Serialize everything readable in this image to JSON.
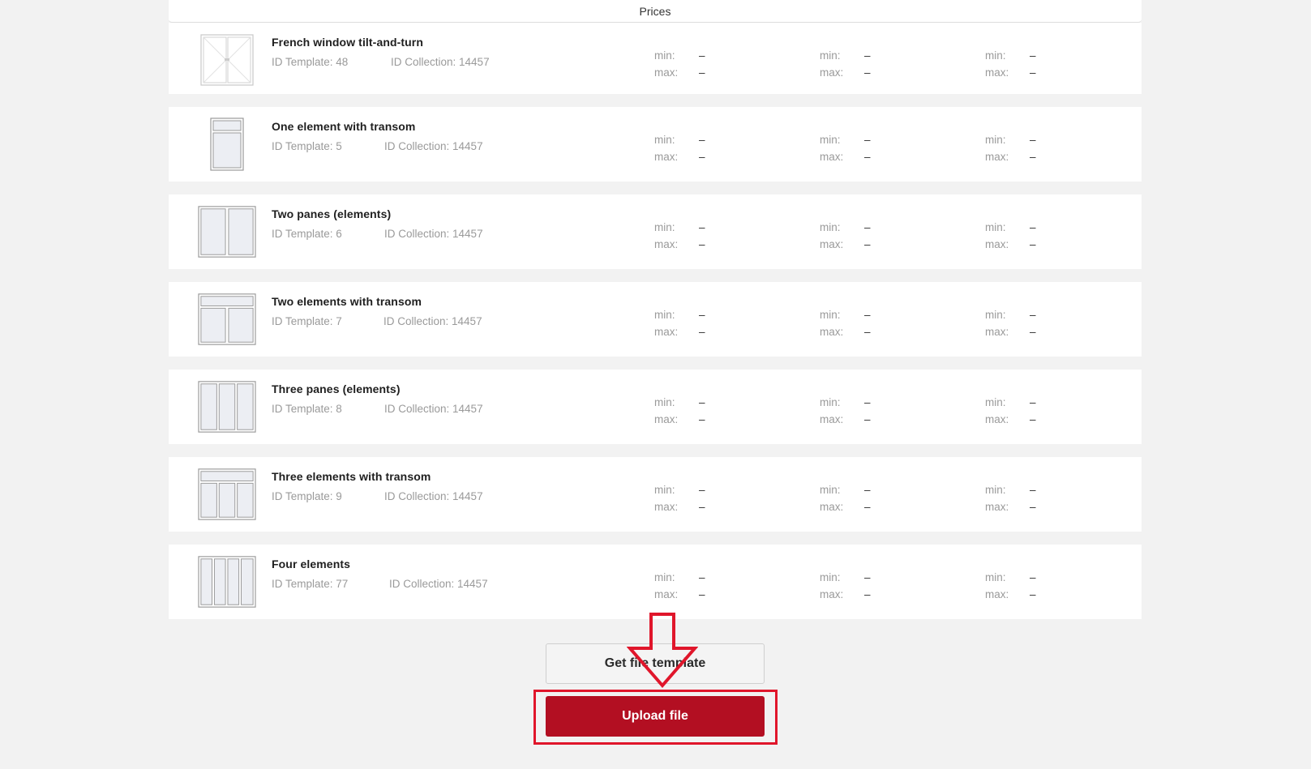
{
  "header": {
    "title": "Prices"
  },
  "price_labels": {
    "min": "min:",
    "max": "max:",
    "empty": "–"
  },
  "templates": [
    {
      "name": "French window tilt-and-turn",
      "id_template": "ID Template: 48",
      "id_collection": "ID Collection: 14457",
      "icon": "french-window-icon"
    },
    {
      "name": "One element with transom",
      "id_template": "ID Template: 5",
      "id_collection": "ID Collection: 14457",
      "icon": "one-element-transom-icon"
    },
    {
      "name": "Two panes (elements)",
      "id_template": "ID Template: 6",
      "id_collection": "ID Collection: 14457",
      "icon": "two-panes-icon"
    },
    {
      "name": "Two elements with transom",
      "id_template": "ID Template: 7",
      "id_collection": "ID Collection: 14457",
      "icon": "two-elements-transom-icon"
    },
    {
      "name": "Three panes (elements)",
      "id_template": "ID Template: 8",
      "id_collection": "ID Collection: 14457",
      "icon": "three-panes-icon"
    },
    {
      "name": "Three elements with transom",
      "id_template": "ID Template: 9",
      "id_collection": "ID Collection: 14457",
      "icon": "three-elements-transom-icon"
    },
    {
      "name": "Four elements",
      "id_template": "ID Template: 77",
      "id_collection": "ID Collection: 14457",
      "icon": "four-elements-icon"
    }
  ],
  "actions": {
    "get_template_label": "Get file template",
    "upload_label": "Upload file"
  },
  "colors": {
    "primary": "#b30f22",
    "highlight": "#e0162b",
    "background": "#f2f2f2"
  }
}
